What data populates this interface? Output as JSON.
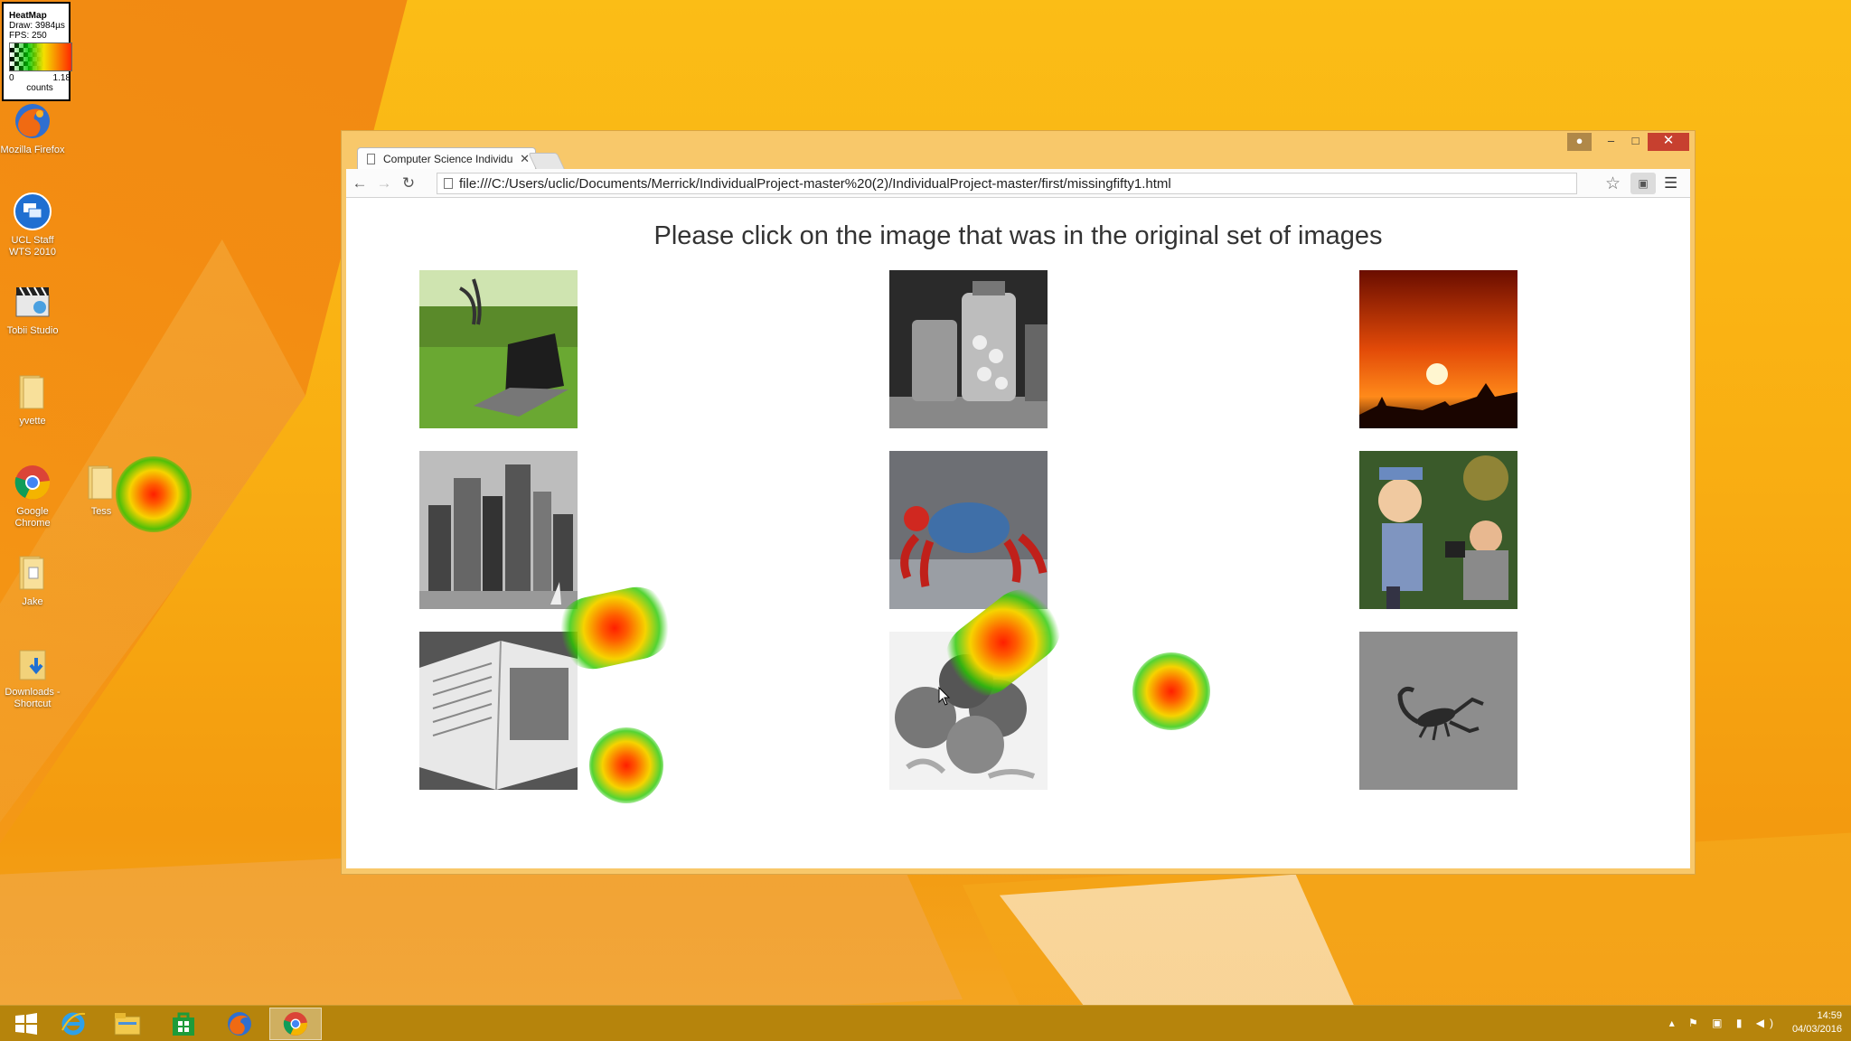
{
  "heatmap_legend": {
    "title": "HeatMap",
    "draw": "Draw: 3984µs",
    "fps": "FPS: 250",
    "min": "0",
    "max": "1.18",
    "unit": "counts"
  },
  "desktop_icons": [
    {
      "label": "Mozilla Firefox",
      "icon": "firefox-icon"
    },
    {
      "label": "UCL Staff WTS 2010",
      "icon": "remote-desktop-icon"
    },
    {
      "label": "Tobii Studio",
      "icon": "tobii-studio-icon"
    },
    {
      "label": "yvette",
      "icon": "folder-icon"
    },
    {
      "label": "Google Chrome",
      "icon": "chrome-icon"
    },
    {
      "label": "Tess",
      "icon": "folder-icon"
    },
    {
      "label": "Jake",
      "icon": "folder-icon"
    },
    {
      "label": "Downloads - Shortcut",
      "icon": "downloads-folder-icon"
    }
  ],
  "browser": {
    "tab_title": "Computer Science Individu",
    "url": "file:///C:/Users/uclic/Documents/Merrick/IndividualProject-master%20(2)/IndividualProject-master/first/missingfifty1.html",
    "window_controls": {
      "minimize": "–",
      "maximize": "□",
      "close": "✕"
    }
  },
  "page": {
    "question": "Please click on the image that was in the original set of images",
    "images": [
      {
        "subject": "laptop on grass"
      },
      {
        "subject": "candy jars"
      },
      {
        "subject": "sunset"
      },
      {
        "subject": "city skyline"
      },
      {
        "subject": "crab"
      },
      {
        "subject": "figurines with camera"
      },
      {
        "subject": "open book"
      },
      {
        "subject": "oranges"
      },
      {
        "subject": "scorpion"
      }
    ]
  },
  "taskbar": {
    "items": [
      "start-icon",
      "internet-explorer-icon",
      "file-explorer-icon",
      "store-icon",
      "firefox-icon",
      "chrome-icon"
    ],
    "active": "chrome-icon",
    "time": "14:59",
    "date": "04/03/2016"
  },
  "colors": {
    "desktop_bg": "#f6a51a",
    "taskbar": "#b6840c",
    "window_frame": "#f8c86a",
    "close_button": "#c7402f"
  }
}
